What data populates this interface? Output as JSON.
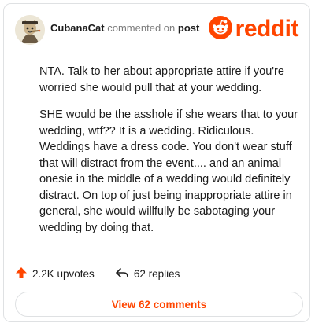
{
  "comment": {
    "author": "CubanaCat",
    "action_text": "commented on",
    "post_link": "post",
    "paragraphs": [
      "NTA. Talk to her about appropriate attire if you're worried she would pull that at your wedding.",
      "SHE would be the asshole if she wears that to your wedding, wtf?? It is a wedding. Ridiculous. Weddings have a dress code. You don't wear stuff that will distract from the event.... and an animal onesie in the middle of a wedding would definitely distract. On top of just being inappropriate attire in general, she would willfully be sabotaging your wedding by doing that."
    ]
  },
  "brand": {
    "wordmark": "reddit",
    "color": "#ff4500",
    "icon": "reddit-alien-icon"
  },
  "actions": {
    "upvotes_label": "2.2K upvotes",
    "upvote_icon": "upvote-arrow-icon",
    "upvote_color": "#ff4500",
    "replies_label": "62 replies",
    "reply_icon": "reply-arrow-icon"
  },
  "footer": {
    "view_comments_label": "View 62 comments"
  },
  "avatar": {
    "icon": "cat-avatar-icon"
  }
}
